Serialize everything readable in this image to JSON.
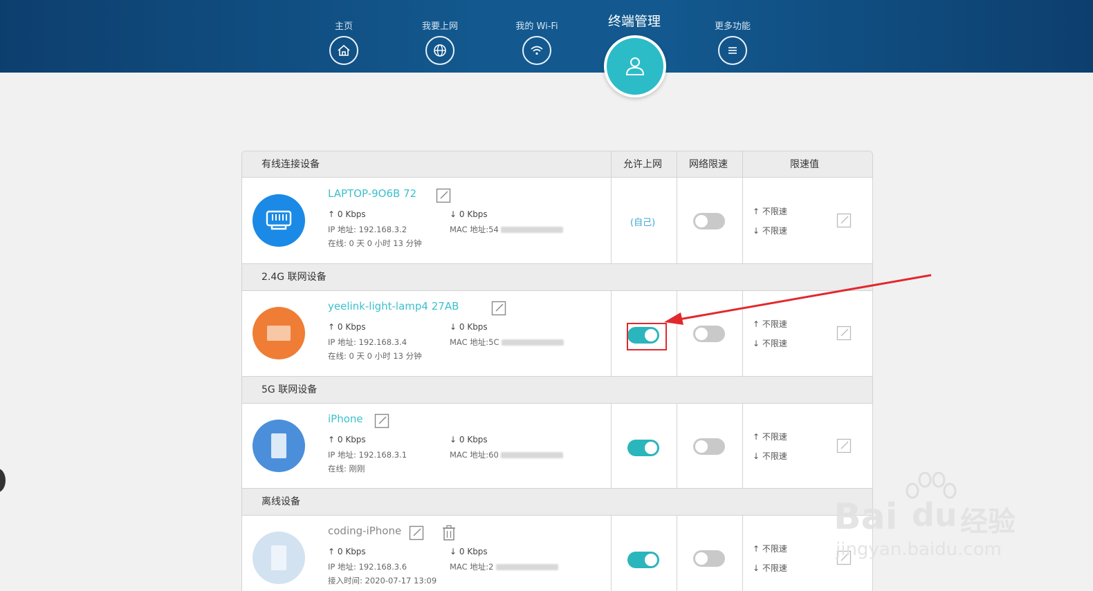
{
  "nav": {
    "items": [
      {
        "label": "主页",
        "icon": "home-icon"
      },
      {
        "label": "我要上网",
        "icon": "globe-icon"
      },
      {
        "label": "我的 Wi-Fi",
        "icon": "wifi-icon"
      },
      {
        "label": "终端管理",
        "icon": "user-icon"
      },
      {
        "label": "更多功能",
        "icon": "menu-icon"
      }
    ]
  },
  "table": {
    "headers": {
      "wired": "有线连接设备",
      "allow": "允许上网",
      "limit_toggle": "网络限速",
      "limit_value": "限速值"
    },
    "sections": {
      "g24": "2.4G 联网设备",
      "g5": "5G 联网设备",
      "offline": "离线设备"
    }
  },
  "devices": [
    {
      "name": "LAPTOP-9O6B  72",
      "up": "0 Kbps",
      "down": "0 Kbps",
      "ip": "IP 地址: 192.168.3.2",
      "mac": "MAC 地址:54",
      "online": "在线: 0 天 0 小时 13 分钟",
      "allow_text": "(自己)",
      "limit_up": "不限速",
      "limit_down": "不限速",
      "avatar_color": "#1a8ae6"
    },
    {
      "name": "yeelink-light-lamp4  27AB",
      "up": "0 Kbps",
      "down": "0 Kbps",
      "ip": "IP 地址: 192.168.3.4",
      "mac": "MAC 地址:5C",
      "online": "在线: 0 天 0 小时 13 分钟",
      "allow": true,
      "limit_up": "不限速",
      "limit_down": "不限速",
      "avatar_color": "#ef7d35"
    },
    {
      "name": "iPhone",
      "up": "0 Kbps",
      "down": "0 Kbps",
      "ip": "IP 地址: 192.168.3.1",
      "mac": "MAC 地址:60",
      "online": "在线: 刚刚",
      "allow": true,
      "limit_up": "不限速",
      "limit_down": "不限速",
      "avatar_color": "#4b8fdb"
    },
    {
      "name": "coding-iPhone",
      "up": "0 Kbps",
      "down": "0 Kbps",
      "ip": "IP 地址: 192.168.3.6",
      "mac": "MAC 地址:2",
      "online": "接入时间: 2020-07-17 13:09",
      "allow": true,
      "limit_up": "不限速",
      "limit_down": "不限速",
      "avatar_color": "#d3e2f1"
    }
  ],
  "watermark": {
    "brand": "Bai",
    "brand2": "du",
    "cn": "经验",
    "url": "jingyan.baidu.com"
  },
  "colors": {
    "header": "#13598f",
    "accent": "#2bbcc8",
    "toggle_on": "#2bb5bc",
    "highlight": "#e2282c"
  }
}
